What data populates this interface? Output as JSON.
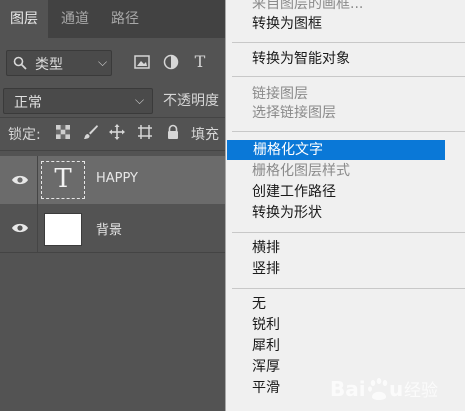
{
  "tabs": [
    {
      "label": "图层",
      "active": true
    },
    {
      "label": "通道",
      "active": false
    },
    {
      "label": "路径",
      "active": false
    }
  ],
  "filter": {
    "selected": "类型",
    "text_icon": "T"
  },
  "blend": {
    "selected": "正常",
    "opacity_label": "不透明度"
  },
  "lock": {
    "label": "锁定:",
    "fill_label": "填充"
  },
  "layers": [
    {
      "name": "HAPPY",
      "thumb_glyph": "T",
      "selected": true,
      "visible": true
    },
    {
      "name": "背景",
      "selected": false,
      "visible": true
    }
  ],
  "menu": {
    "items": [
      {
        "label": "来自图层的画框...",
        "disabled": true
      },
      {
        "label": "转换为图框",
        "disabled": false
      },
      {
        "label": "转换为智能对象",
        "disabled": false
      },
      {
        "label": "链接图层",
        "disabled": true
      },
      {
        "label": "选择链接图层",
        "disabled": true
      },
      {
        "label": "栅格化文字",
        "disabled": false,
        "highlighted": true
      },
      {
        "label": "栅格化图层样式",
        "disabled": true
      },
      {
        "label": "创建工作路径",
        "disabled": false
      },
      {
        "label": "转换为形状",
        "disabled": false
      },
      {
        "label": "横排",
        "disabled": false
      },
      {
        "label": "竖排",
        "disabled": false
      },
      {
        "label": "无",
        "disabled": false
      },
      {
        "label": "锐利",
        "disabled": false
      },
      {
        "label": "犀利",
        "disabled": false
      },
      {
        "label": "浑厚",
        "disabled": false
      },
      {
        "label": "平滑",
        "disabled": false
      }
    ]
  },
  "watermark": {
    "text": "Baidu 经验"
  },
  "colors": {
    "menu_highlight": "#0a78d7",
    "panel_bg": "#535353",
    "selected_layer": "#6b6b6b"
  }
}
